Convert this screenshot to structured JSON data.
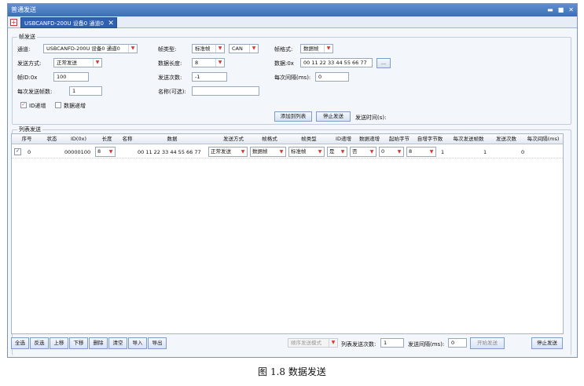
{
  "window": {
    "title": "普通发送",
    "min": "▬",
    "max": "■",
    "close": "✕"
  },
  "tabs": {
    "new": "+",
    "active": "USBCANFD-200U 设备0 通道0",
    "close": "✕"
  },
  "frame_send": {
    "group": "帧发送",
    "channel_label": "通道:",
    "channel_value": "USBCANFD-200U 设备0 通道0",
    "frame_type_label": "帧类型:",
    "frame_type_value": "标准帧",
    "proto_value": "CAN",
    "frame_format_label": "帧格式:",
    "frame_format_value": "数据帧",
    "send_mode_label": "发送方式:",
    "send_mode_value": "正常发送",
    "data_len_label": "数据长度:",
    "data_len_value": "8",
    "data_label": "数据:0x",
    "data_value": "00 11 22 33 44 55 66 77",
    "data_more": "...",
    "frame_id_label": "帧ID:0x",
    "frame_id_value": "100",
    "send_count_label": "发送次数:",
    "send_count_value": "-1",
    "interval_label": "每次间隔(ms):",
    "interval_value": "0",
    "frames_per_send_label": "每次发送帧数:",
    "frames_per_send_value": "1",
    "name_label": "名称(可选):",
    "name_value": "",
    "id_inc_label": "ID递增",
    "data_inc_label": "数据递增",
    "add_to_list": "添加到列表",
    "stop_send": "停止发送",
    "send_time_label": "发送时间(s):"
  },
  "list_send": {
    "group": "列表发送",
    "columns": [
      "序号",
      "状态",
      "ID(0x)",
      "长度",
      "名称",
      "数据",
      "发送方式",
      "帧格式",
      "帧类型",
      "ID递增",
      "数据递增",
      "起始字节",
      "自增字节数",
      "每次发送帧数",
      "发送次数",
      "每次间隔(ms)"
    ],
    "row": {
      "index": "0",
      "status": "",
      "id": "00000100",
      "len": "8",
      "name": "",
      "data": "00 11 22 33 44 55 66 77",
      "mode": "正常发送",
      "format": "数据帧",
      "type": "标准帧",
      "id_inc": "是",
      "data_inc": "否",
      "start_byte": "0",
      "inc_bytes": "8",
      "frames": "1",
      "count": "1",
      "interval": "0"
    }
  },
  "bottom": {
    "buttons": [
      "全选",
      "反选",
      "上移",
      "下移",
      "删除",
      "清空",
      "导入",
      "导出"
    ],
    "seq_mode": "顺序发送模式",
    "list_count_label": "列表发送次数:",
    "list_count_value": "1",
    "interval_label": "发送间隔(ms):",
    "interval_value": "0",
    "start_label": "开始发送",
    "stop_label": "停止发送"
  },
  "caption": "图 1.8    数据发送"
}
